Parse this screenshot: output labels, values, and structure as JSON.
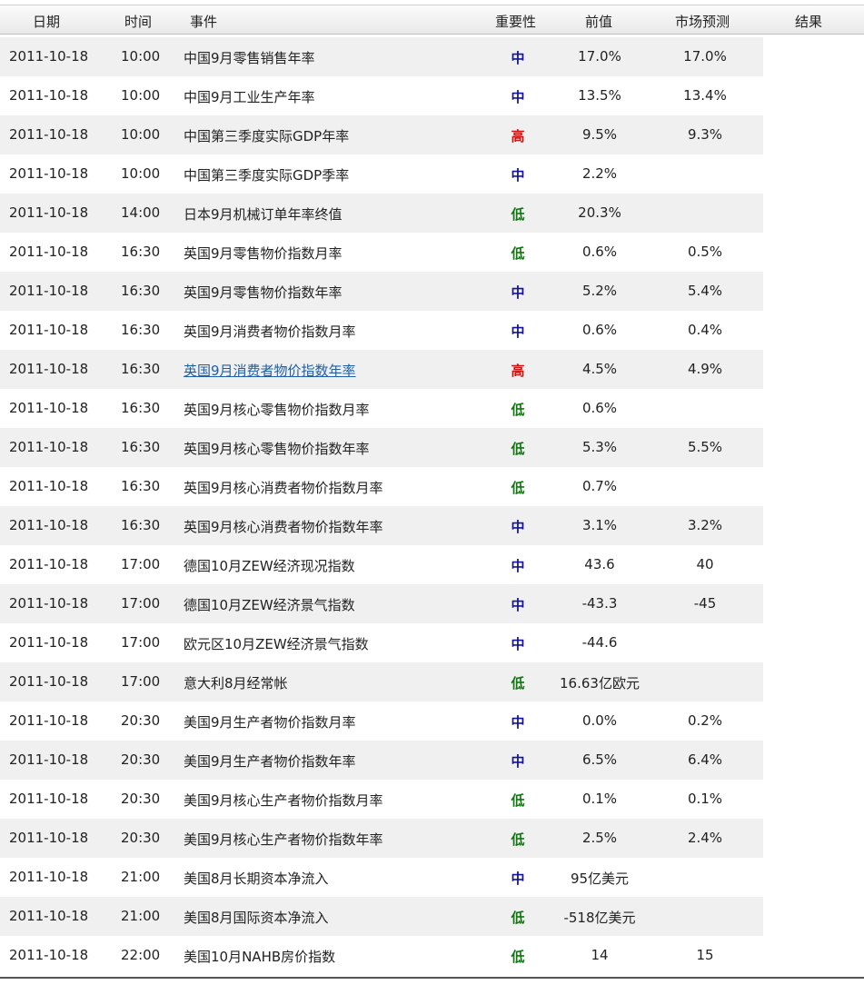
{
  "header": {
    "date": "日期",
    "time": "时间",
    "event": "事件",
    "importance": "重要性",
    "previous": "前值",
    "forecast": "市场预测",
    "result": "结果"
  },
  "colors": {
    "high": "#cc1111",
    "medium": "#12129a",
    "low": "#117711",
    "link": "#1f5fa8"
  },
  "rows": [
    {
      "date": "2011-10-18",
      "time": "10:00",
      "event": "中国9月零售销售年率",
      "importance": "中",
      "level": "medium",
      "previous": "17.0%",
      "forecast": "17.0%",
      "result": ""
    },
    {
      "date": "2011-10-18",
      "time": "10:00",
      "event": "中国9月工业生产年率",
      "importance": "中",
      "level": "medium",
      "previous": "13.5%",
      "forecast": "13.4%",
      "result": ""
    },
    {
      "date": "2011-10-18",
      "time": "10:00",
      "event": "中国第三季度实际GDP年率",
      "importance": "高",
      "level": "high",
      "previous": "9.5%",
      "forecast": "9.3%",
      "result": ""
    },
    {
      "date": "2011-10-18",
      "time": "10:00",
      "event": "中国第三季度实际GDP季率",
      "importance": "中",
      "level": "medium",
      "previous": "2.2%",
      "forecast": "",
      "result": ""
    },
    {
      "date": "2011-10-18",
      "time": "14:00",
      "event": "日本9月机械订单年率终值",
      "importance": "低",
      "level": "low",
      "previous": "20.3%",
      "forecast": "",
      "result": ""
    },
    {
      "date": "2011-10-18",
      "time": "16:30",
      "event": "英国9月零售物价指数月率",
      "importance": "低",
      "level": "low",
      "previous": "0.6%",
      "forecast": "0.5%",
      "result": ""
    },
    {
      "date": "2011-10-18",
      "time": "16:30",
      "event": "英国9月零售物价指数年率",
      "importance": "中",
      "level": "medium",
      "previous": "5.2%",
      "forecast": "5.4%",
      "result": ""
    },
    {
      "date": "2011-10-18",
      "time": "16:30",
      "event": "英国9月消费者物价指数月率",
      "importance": "中",
      "level": "medium",
      "previous": "0.6%",
      "forecast": "0.4%",
      "result": ""
    },
    {
      "date": "2011-10-18",
      "time": "16:30",
      "event": "英国9月消费者物价指数年率",
      "importance": "高",
      "level": "high",
      "previous": "4.5%",
      "forecast": "4.9%",
      "result": "",
      "link": true
    },
    {
      "date": "2011-10-18",
      "time": "16:30",
      "event": "英国9月核心零售物价指数月率",
      "importance": "低",
      "level": "low",
      "previous": "0.6%",
      "forecast": "",
      "result": ""
    },
    {
      "date": "2011-10-18",
      "time": "16:30",
      "event": "英国9月核心零售物价指数年率",
      "importance": "低",
      "level": "low",
      "previous": "5.3%",
      "forecast": "5.5%",
      "result": ""
    },
    {
      "date": "2011-10-18",
      "time": "16:30",
      "event": "英国9月核心消费者物价指数月率",
      "importance": "低",
      "level": "low",
      "previous": "0.7%",
      "forecast": "",
      "result": ""
    },
    {
      "date": "2011-10-18",
      "time": "16:30",
      "event": "英国9月核心消费者物价指数年率",
      "importance": "中",
      "level": "medium",
      "previous": "3.1%",
      "forecast": "3.2%",
      "result": ""
    },
    {
      "date": "2011-10-18",
      "time": "17:00",
      "event": "德国10月ZEW经济现况指数",
      "importance": "中",
      "level": "medium",
      "previous": "43.6",
      "forecast": "40",
      "result": ""
    },
    {
      "date": "2011-10-18",
      "time": "17:00",
      "event": "德国10月ZEW经济景气指数",
      "importance": "中",
      "level": "medium",
      "previous": "-43.3",
      "forecast": "-45",
      "result": ""
    },
    {
      "date": "2011-10-18",
      "time": "17:00",
      "event": "欧元区10月ZEW经济景气指数",
      "importance": "中",
      "level": "medium",
      "previous": "-44.6",
      "forecast": "",
      "result": ""
    },
    {
      "date": "2011-10-18",
      "time": "17:00",
      "event": "意大利8月经常帐",
      "importance": "低",
      "level": "low",
      "previous": "16.63亿欧元",
      "forecast": "",
      "result": ""
    },
    {
      "date": "2011-10-18",
      "time": "20:30",
      "event": "美国9月生产者物价指数月率",
      "importance": "中",
      "level": "medium",
      "previous": "0.0%",
      "forecast": "0.2%",
      "result": ""
    },
    {
      "date": "2011-10-18",
      "time": "20:30",
      "event": "美国9月生产者物价指数年率",
      "importance": "中",
      "level": "medium",
      "previous": "6.5%",
      "forecast": "6.4%",
      "result": ""
    },
    {
      "date": "2011-10-18",
      "time": "20:30",
      "event": "美国9月核心生产者物价指数月率",
      "importance": "低",
      "level": "low",
      "previous": "0.1%",
      "forecast": "0.1%",
      "result": ""
    },
    {
      "date": "2011-10-18",
      "time": "20:30",
      "event": "美国9月核心生产者物价指数年率",
      "importance": "低",
      "level": "low",
      "previous": "2.5%",
      "forecast": "2.4%",
      "result": ""
    },
    {
      "date": "2011-10-18",
      "time": "21:00",
      "event": "美国8月长期资本净流入",
      "importance": "中",
      "level": "medium",
      "previous": "95亿美元",
      "forecast": "",
      "result": ""
    },
    {
      "date": "2011-10-18",
      "time": "21:00",
      "event": "美国8月国际资本净流入",
      "importance": "低",
      "level": "low",
      "previous": "-518亿美元",
      "forecast": "",
      "result": ""
    },
    {
      "date": "2011-10-18",
      "time": "22:00",
      "event": "美国10月NAHB房价指数",
      "importance": "低",
      "level": "low",
      "previous": "14",
      "forecast": "15",
      "result": ""
    }
  ]
}
